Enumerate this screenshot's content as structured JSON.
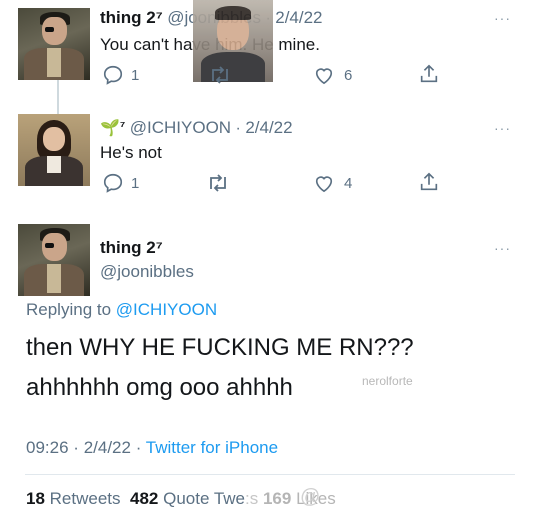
{
  "tweet1": {
    "name": "thing 2⁷",
    "handle": "@joonibbles",
    "sep": "·",
    "date": "2/4/22",
    "text": "You can't have him. He mine.",
    "replies": "1",
    "likes": "6",
    "more_label": "···"
  },
  "tweet2": {
    "name_suffix": "⁷",
    "handle": "@ICHIYOON",
    "sep": "·",
    "date": "2/4/22",
    "text": "He's not",
    "replies": "1",
    "likes": "4",
    "more_label": "···"
  },
  "main": {
    "name": "thing 2⁷",
    "handle": "@joonibbles",
    "replying_prefix": "Replying to",
    "replying_handle": "@ICHIYOON",
    "line1": "then WHY HE FUCKING ME RN???",
    "line2": "ahhhhhh omg ooo ahhhh",
    "watermark": "nerolforte",
    "time": "09:26",
    "sep": "·",
    "date": "2/4/22",
    "source": "Twitter for iPhone",
    "retweets_count": "18",
    "retweets_label": "Retweets",
    "quotes_count": "482",
    "quotes_label": "Quote Twe",
    "quotes_overlay": ":s",
    "likes_count": "169",
    "likes_label": "Likes",
    "overlay_mark": "@",
    "more_label": "···"
  },
  "colors": {
    "link": "#1d9bf0",
    "secondary": "#5b7083",
    "text": "#14171a",
    "sprout": "#4caf50"
  }
}
